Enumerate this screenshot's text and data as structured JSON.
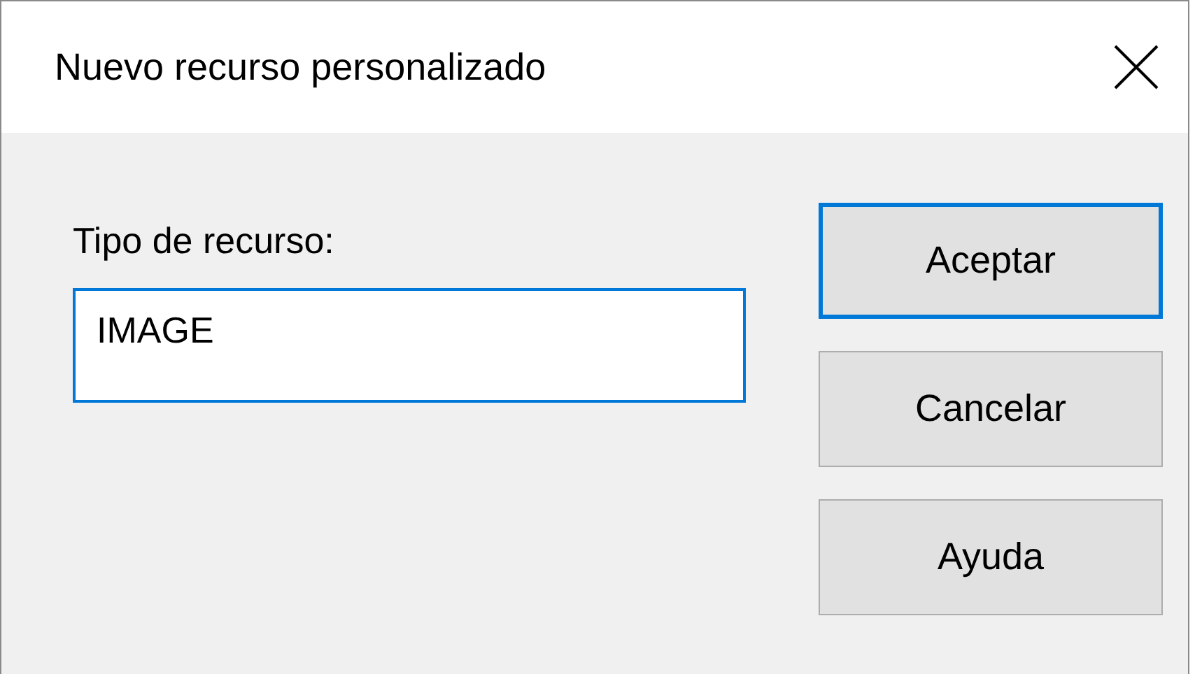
{
  "window": {
    "title": "Nuevo recurso personalizado"
  },
  "field": {
    "label": "Tipo de recurso:",
    "value": "IMAGE",
    "focused": true
  },
  "buttons": [
    {
      "label": "Aceptar",
      "default": true
    },
    {
      "label": "Cancelar",
      "default": false
    },
    {
      "label": "Ayuda",
      "default": false
    }
  ]
}
